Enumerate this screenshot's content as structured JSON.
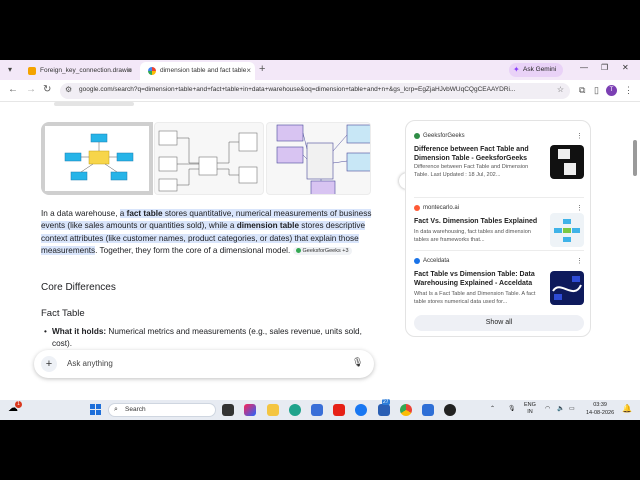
{
  "browser": {
    "tabs": [
      {
        "title": "Foreign_key_connection.drawio",
        "active": false
      },
      {
        "title": "dimension table and fact table",
        "active": true
      }
    ],
    "ask_gemini": "Ask Gemini",
    "url": "google.com/search?q=dimension+table+and+fact+table+in+data+warehouse&oq=dimension+table+and+n+&gs_lcrp=EgZjaHJvbWUqCQgCEAAYDRi...",
    "profile_initial": "T"
  },
  "overview": {
    "paragraph": {
      "p1": "In a data warehouse, ",
      "h1_pre": "a ",
      "h1_bold": "fact table",
      "h1_post": " stores quantitative, numerical measurements of business events (like sales amounts or quantities sold), while a ",
      "h2_bold": "dimension table",
      "h2_post": " stores descriptive context attributes (like customer names, product categories, or dates) that explain those measurements",
      "p2": ". Together, they form the core of a dimensional model.",
      "cite": "GeeksforGeeks +3"
    },
    "section_title": "Core Differences",
    "subsection_title": "Fact Table",
    "bullet": {
      "label": "What it holds:",
      "text": " Numerical metrics and measurements (e.g., sales revenue, units sold, cost)."
    }
  },
  "ask_bar": {
    "placeholder": "Ask anything"
  },
  "sources": [
    {
      "site": "GeeksforGeeks",
      "title": "Difference between Fact Table and Dimension Table - GeeksforGeeks",
      "desc": "Difference between Fact Table and Dimension Table. Last Updated : 18 Jul, 202...",
      "color": "#2f8d46"
    },
    {
      "site": "montecarlo.ai",
      "title": "Fact Vs. Dimension Tables Explained",
      "desc": "In data warehousing, fact tables and dimension tables are frameworks that...",
      "color": "#ff5a36"
    },
    {
      "site": "Acceldata",
      "title": "Fact Table vs Dimension Table: Data Warehousing Explained - Acceldata",
      "desc": "What Is a Fact Table and Dimension Table. A fact table stores numerical data used for...",
      "color": "#1a73e8"
    }
  ],
  "show_all": "Show all",
  "taskbar": {
    "weather_badge": "1",
    "search": "Search",
    "badge_count": "27",
    "lang_line1": "ENG",
    "lang_line2": "IN",
    "time": "03:39",
    "date": "14-08-2026"
  }
}
